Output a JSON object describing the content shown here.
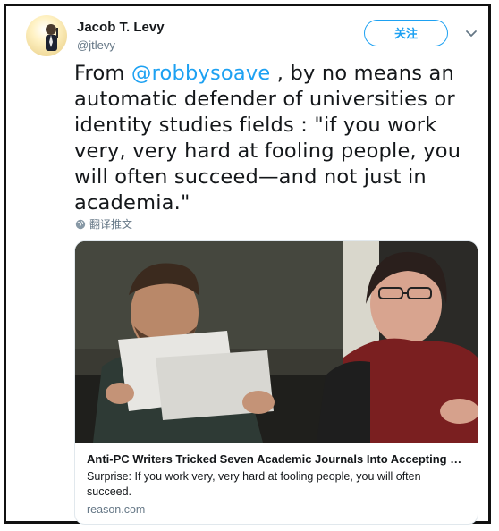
{
  "author": {
    "name": "Jacob T. Levy",
    "handle": "@jtlevy"
  },
  "actions": {
    "follow_label": "关注"
  },
  "tweet": {
    "prefix": "From ",
    "mention": "@robbysoave",
    "body": " , by no means an automatic defender of universities or identity studies fields : \"if you work very, very hard at fooling people, you will often succeed—and not just in academia.\"",
    "translate_label": "翻译推文"
  },
  "card": {
    "title": "Anti-PC Writers Tricked Seven Academic Journals Into Accepting Ho...",
    "description": "Surprise: If you work very, very hard at fooling people, you will often succeed.",
    "domain": "reason.com"
  },
  "colors": {
    "accent": "#1da1f2",
    "text": "#14171a",
    "muted": "#657786"
  }
}
